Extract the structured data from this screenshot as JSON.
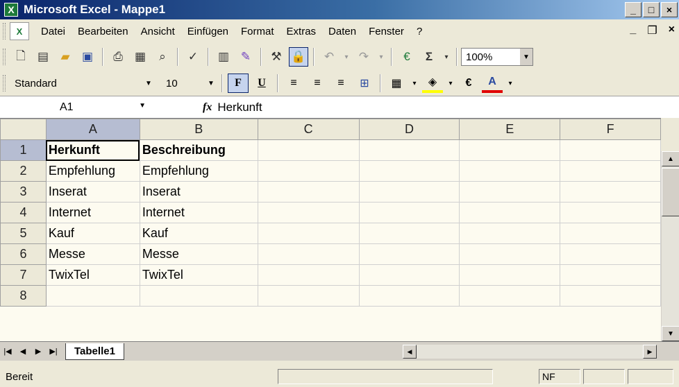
{
  "window": {
    "title": "Microsoft Excel - Mappe1"
  },
  "menu": {
    "items": [
      "Datei",
      "Bearbeiten",
      "Ansicht",
      "Einfügen",
      "Format",
      "Extras",
      "Daten",
      "Fenster",
      "?"
    ]
  },
  "toolbar": {
    "zoom": "100%",
    "icons": [
      "new-icon",
      "print-preview-icon",
      "open-folder-icon",
      "save-icon",
      "print-icon",
      "research-icon",
      "preview-icon",
      "spelling-icon",
      "calendar-icon",
      "brush-icon",
      "tools-icon",
      "lock-icon",
      "undo-icon",
      "redo-icon",
      "euro-converter-icon",
      "sum-icon"
    ]
  },
  "format": {
    "style": "Standard",
    "size": "10",
    "bold": "F",
    "underline": "U",
    "euro": "€",
    "font_color_letter": "A"
  },
  "formula": {
    "cell_ref": "A1",
    "fx": "fx",
    "value": "Herkunft"
  },
  "grid": {
    "columns": [
      "A",
      "B",
      "C",
      "D",
      "E",
      "F"
    ],
    "rows": [
      {
        "num": "1",
        "a": "Herkunft",
        "b": "Beschreibung"
      },
      {
        "num": "2",
        "a": "Empfehlung",
        "b": "Empfehlung"
      },
      {
        "num": "3",
        "a": "Inserat",
        "b": "Inserat"
      },
      {
        "num": "4",
        "a": "Internet",
        "b": "Internet"
      },
      {
        "num": "5",
        "a": "Kauf",
        "b": "Kauf"
      },
      {
        "num": "6",
        "a": "Messe",
        "b": "Messe"
      },
      {
        "num": "7",
        "a": "TwixTel",
        "b": "TwixTel"
      },
      {
        "num": "8",
        "a": "",
        "b": ""
      }
    ]
  },
  "sheets": {
    "active": "Tabelle1"
  },
  "status": {
    "text": "Bereit",
    "nf": "NF"
  },
  "colors": {
    "title_start": "#0a246a",
    "title_end": "#a6caf0",
    "grid_bg": "#fdfbf0",
    "selected_header": "#b6bdd2"
  }
}
